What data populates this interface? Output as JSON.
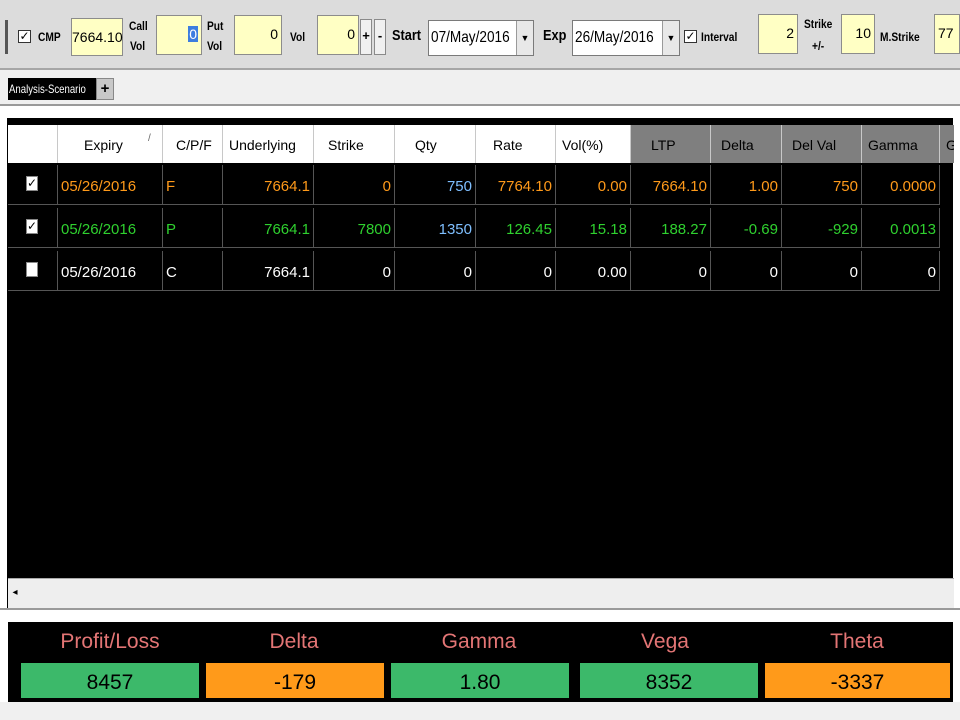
{
  "toolbar": {
    "cmp_label": "CMP",
    "cmp_value": "7664.10",
    "call_vol_label_1": "Call",
    "call_vol_label_2": "Vol",
    "call_vol_value": "0",
    "put_vol_label_1": "Put",
    "put_vol_label_2": "Vol",
    "put_vol_value": "0",
    "vol_label": "Vol",
    "vol_value": "0",
    "plus_label": "+",
    "minus_label": "-",
    "start_label": "Start",
    "start_date": "07/May/2016",
    "exp_label": "Exp",
    "exp_date": "26/May/2016",
    "interval_label": "Interval",
    "interval_value": "2",
    "strike_label_1": "Strike",
    "strike_label_2": "+/-",
    "strike_value": "10",
    "mstrike_label": "M.Strike",
    "mstrike_value": "77",
    "cmp_checked": true,
    "interval_checked": true
  },
  "tabs": {
    "active_label": "Analysis-Scenario",
    "add_label": "+"
  },
  "grid": {
    "columns": [
      "Expiry",
      "/",
      "C/P/F",
      "Underlying",
      "Strike",
      "Qty",
      "Rate",
      "Vol(%)",
      "LTP",
      "Delta",
      "Del Val",
      "Gamma",
      "G"
    ],
    "rows": [
      {
        "checked": true,
        "expiry": "05/26/2016",
        "cpf": "F",
        "underlying": "7664.1",
        "strike": "0",
        "qty": "750",
        "rate": "7764.10",
        "vol": "0.00",
        "ltp": "7664.10",
        "delta": "1.00",
        "delval": "750",
        "gamma": "0.0000"
      },
      {
        "checked": true,
        "expiry": "05/26/2016",
        "cpf": "P",
        "underlying": "7664.1",
        "strike": "7800",
        "qty": "1350",
        "rate": "126.45",
        "vol": "15.18",
        "ltp": "188.27",
        "delta": "-0.69",
        "delval": "-929",
        "gamma": "0.0013"
      },
      {
        "checked": false,
        "expiry": "05/26/2016",
        "cpf": "C",
        "underlying": "7664.1",
        "strike": "0",
        "qty": "0",
        "rate": "0",
        "vol": "0.00",
        "ltp": "0",
        "delta": "0",
        "delval": "0",
        "gamma": "0"
      }
    ],
    "scroll_left_icon": "◂"
  },
  "summary": {
    "labels": [
      "Profit/Loss",
      "Delta",
      "Gamma",
      "Vega",
      "Theta"
    ],
    "values": [
      "8457",
      "-179",
      "1.80",
      "8352",
      "-3337"
    ],
    "colors": [
      "#3cb96a",
      "#ff9a1a",
      "#3cb96a",
      "#3cb96a",
      "#ff9a1a"
    ]
  },
  "colors": {
    "row_orange": "#ff9a1a",
    "row_green": "#2fd12f",
    "qty_blue": "#7fbfff",
    "label_red": "#e37575"
  }
}
